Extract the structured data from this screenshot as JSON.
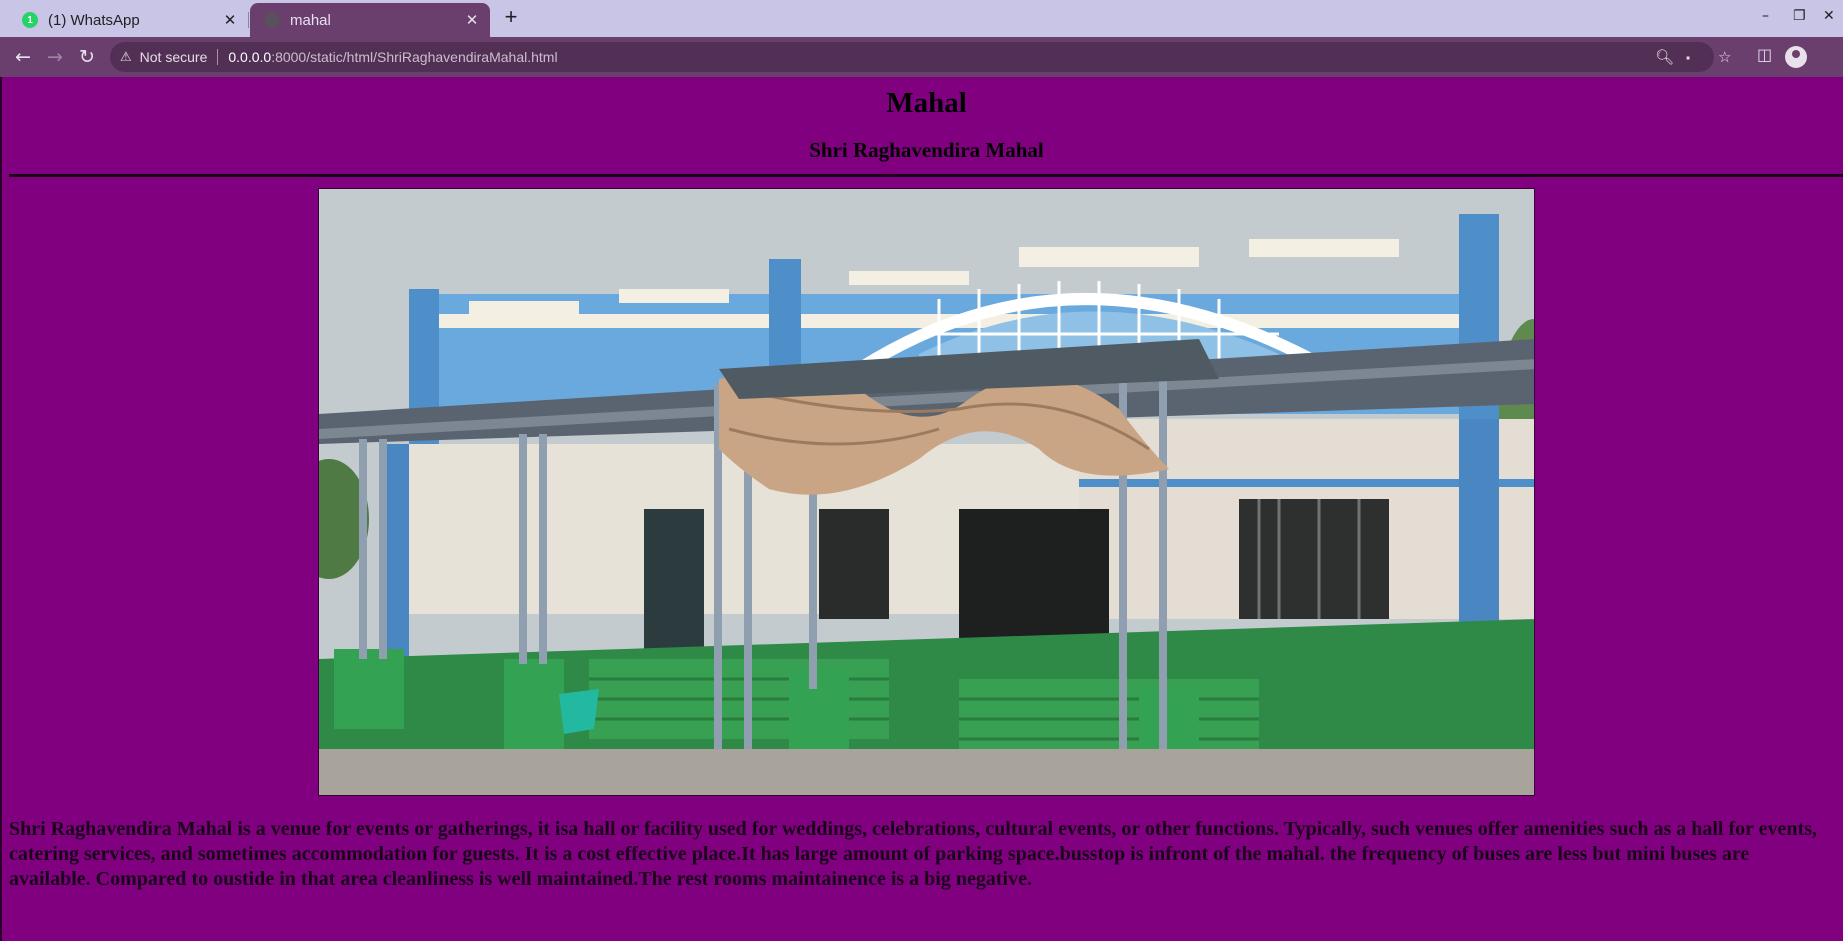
{
  "browser": {
    "tabs": [
      {
        "title": "(1) WhatsApp",
        "badge": "1"
      },
      {
        "title": "mahal"
      }
    ],
    "address": {
      "security_label": "Not secure",
      "host": "0.0.0.0",
      "path": ":8000/static/html/ShriRaghavendiraMahal.html"
    }
  },
  "page": {
    "title": "Mahal",
    "subtitle": "Shri Raghavendira Mahal",
    "description": "Shri Raghavendira Mahal is a venue for events or gatherings, it isa hall or facility used for weddings, celebrations, cultural events, or other functions. Typically, such venues offer amenities such as a hall for events, catering services, and sometimes accommodation for guests. It is a cost effective place.It has large amount of parking space.busstop is infront of the mahal. the frequency of buses are less but mini buses are available. Compared to oustide in that area cleanliness is well maintained.The rest rooms maintainence is a big negative.",
    "background_color": "#800080"
  }
}
